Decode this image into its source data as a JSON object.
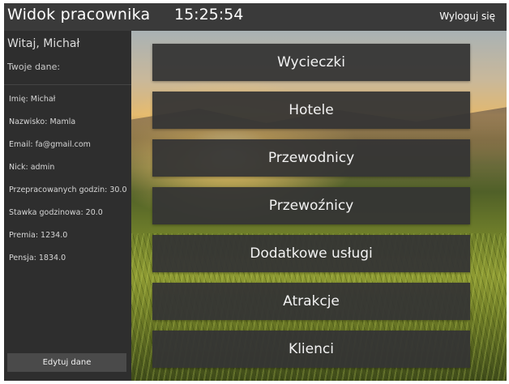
{
  "header": {
    "title": "Widok pracownika",
    "time": "15:25:54",
    "logout": "Wyloguj się"
  },
  "sidebar": {
    "greeting": "Witaj, Michał",
    "your_data": "Twoje dane:",
    "fields": [
      "Imię: Michał",
      "Nazwisko: Mamla",
      "Email: fa@gmail.com",
      "Nick: admin",
      "Przepracowanych godzin: 30.0",
      "Stawka godzinowa: 20.0",
      "Premia: 1234.0",
      "Pensja: 1834.0"
    ],
    "edit_button": "Edytuj dane"
  },
  "menu": [
    "Wycieczki",
    "Hotele",
    "Przewodnicy",
    "Przewoźnicy",
    "Dodatkowe usługi",
    "Atrakcje",
    "Klienci"
  ]
}
